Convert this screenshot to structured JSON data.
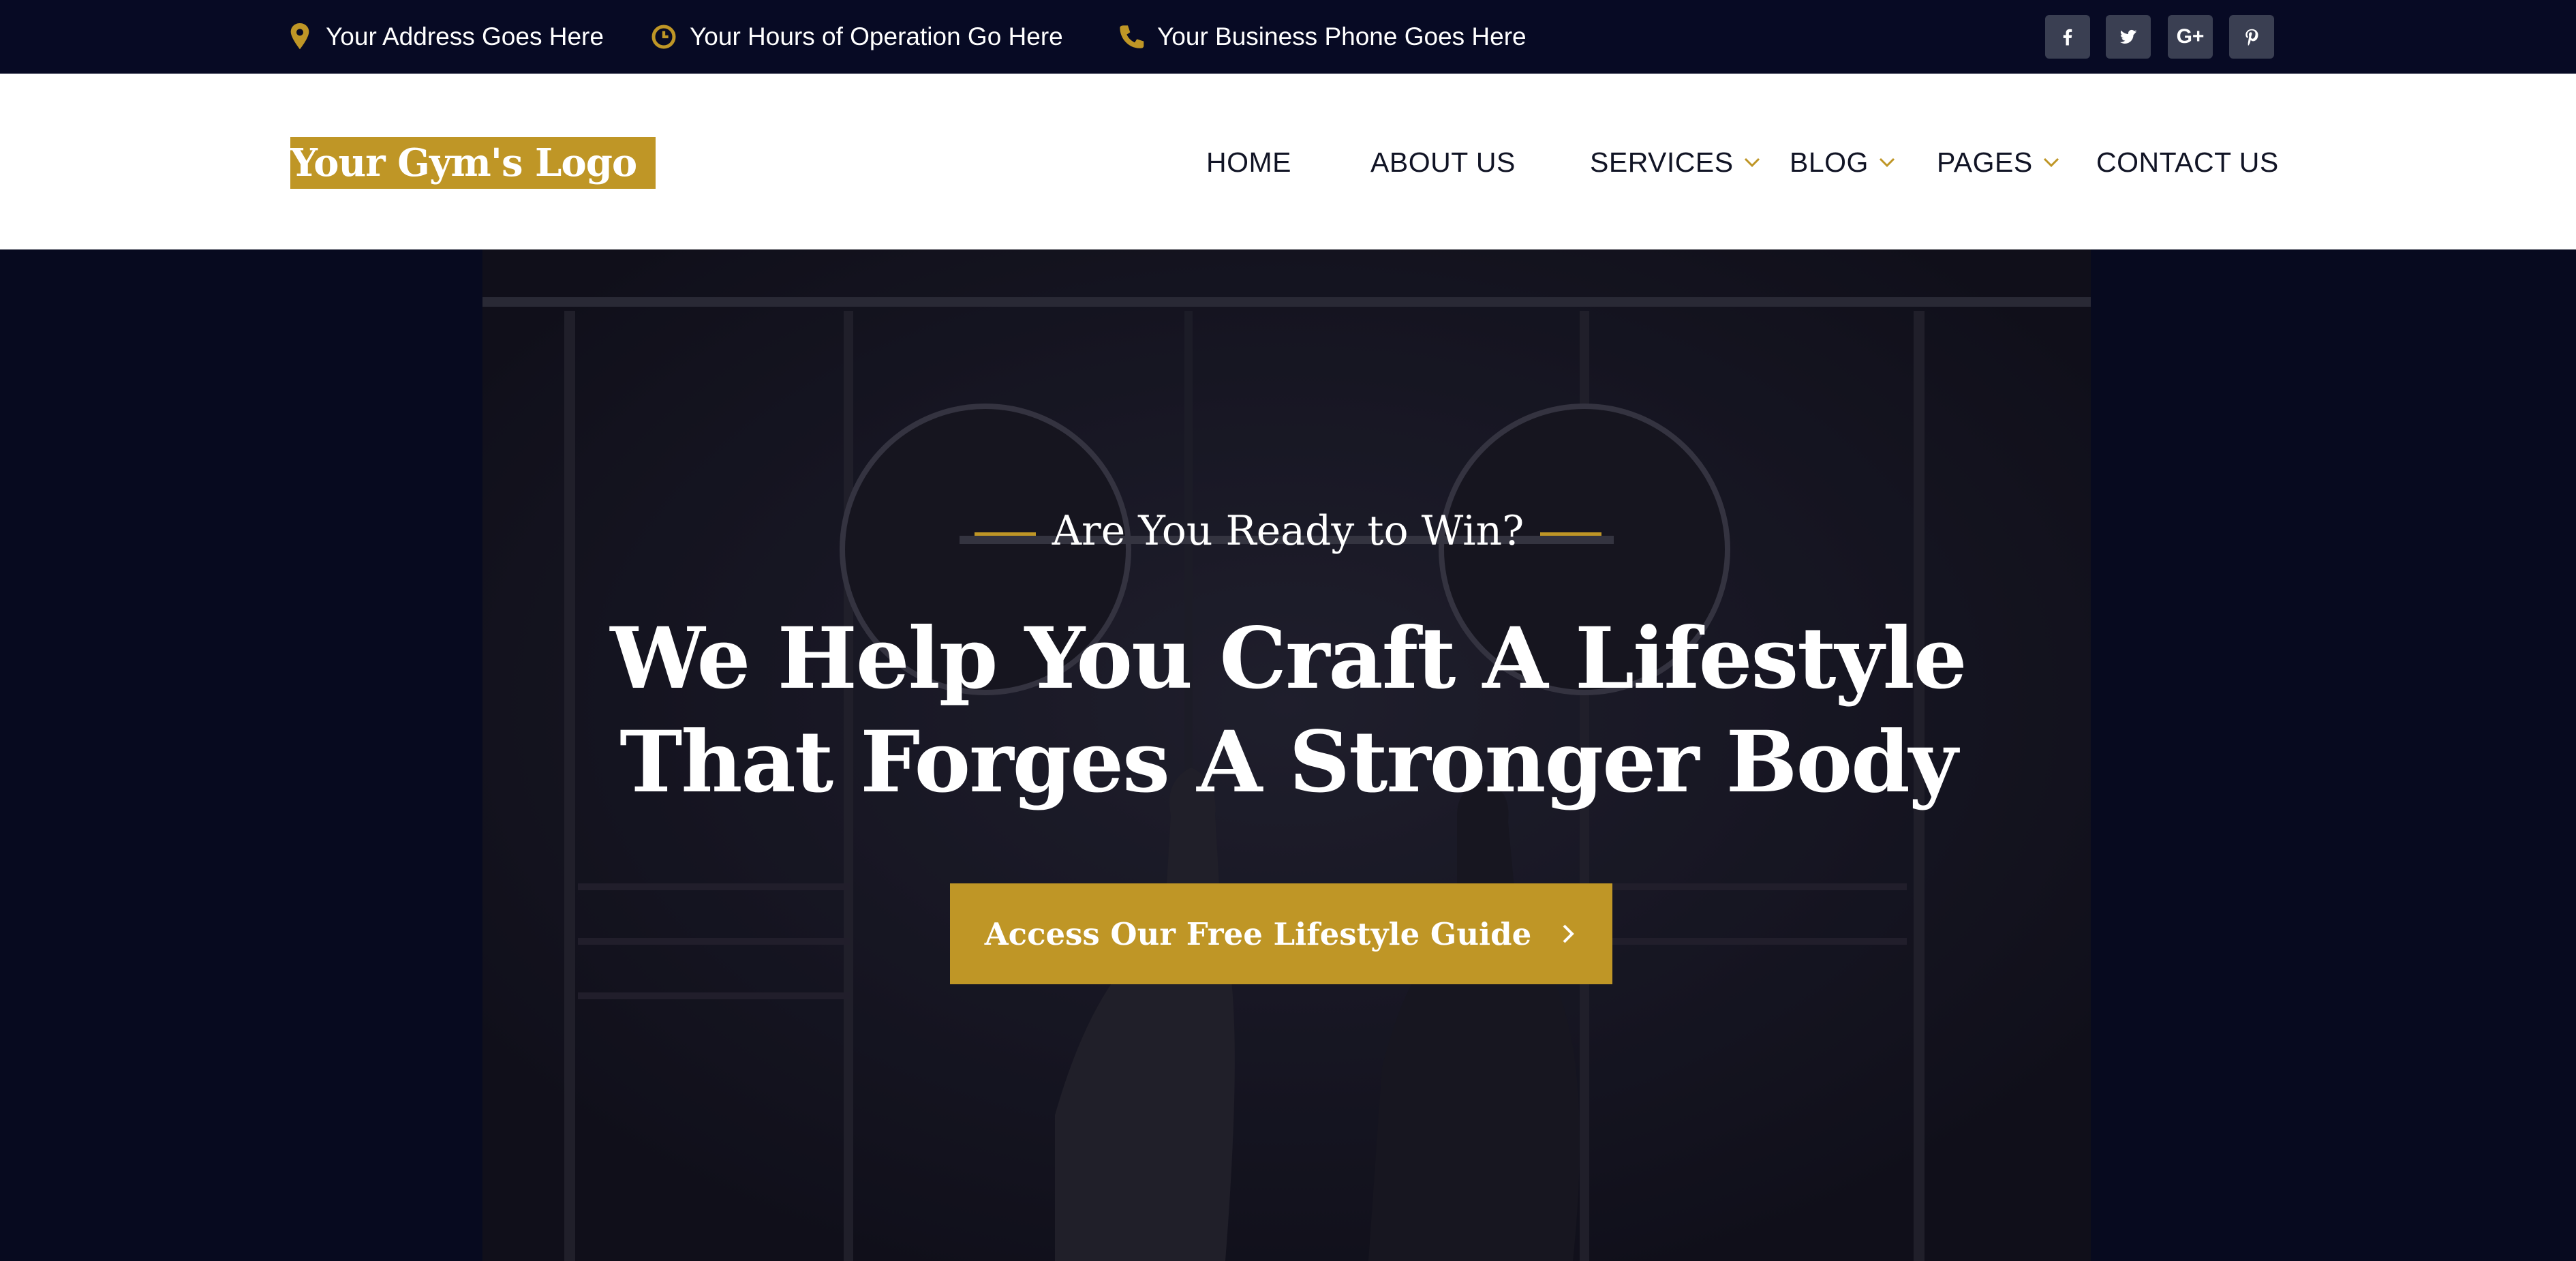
{
  "topbar": {
    "address": "Your Address Goes Here",
    "hours": "Your Hours of Operation Go Here",
    "phone": "Your Business Phone Goes Here",
    "icons": [
      "map-pin-icon",
      "clock-icon",
      "phone-icon"
    ],
    "social": [
      "facebook",
      "twitter",
      "google-plus",
      "pinterest"
    ],
    "social_gplus_label": "G+"
  },
  "header": {
    "logo": "Your Gym's Logo",
    "nav": {
      "home": "HOME",
      "about": "ABOUT US",
      "services": "SERVICES",
      "blog": "BLOG",
      "pages": "PAGES",
      "contact": "CONTACT US"
    }
  },
  "hero": {
    "eyebrow": "Are You Ready to Win?",
    "headline_line1": "We Help You Craft A Lifestyle",
    "headline_line2": "That Forges A Stronger Body",
    "cta_label": "Access Our Free Lifestyle Guide"
  },
  "colors": {
    "accent": "#bf9626",
    "topbar_bg": "#070a24",
    "hero_bg": "#070a1f",
    "nav_text": "#111425"
  }
}
